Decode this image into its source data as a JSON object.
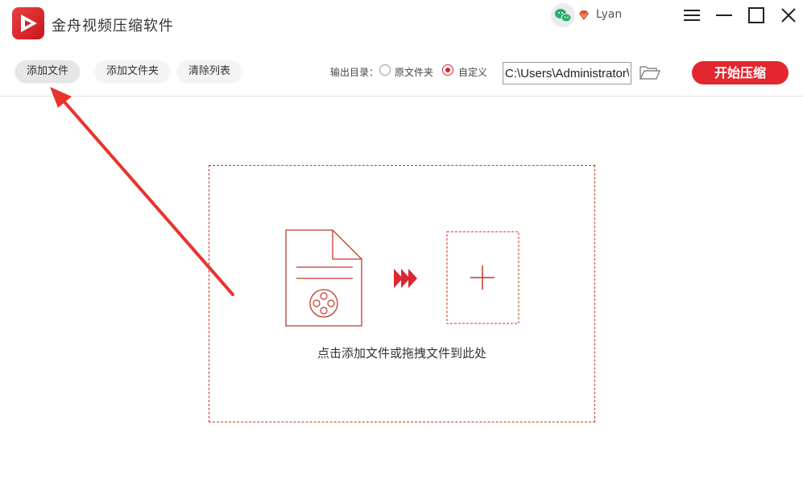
{
  "app": {
    "title": "金舟视频压缩软件",
    "logo_icon": "play-logo-icon",
    "brand_color": "#e2272e"
  },
  "user": {
    "name": "Lyan",
    "wechat_icon": "wechat-icon",
    "vip_icon": "vip-diamond-icon"
  },
  "window_controls": [
    "menu-icon",
    "minimize-icon",
    "maximize-icon",
    "close-icon"
  ],
  "toolbar": {
    "add_file": "添加文件",
    "add_folder": "添加文件夹",
    "clear_list": "清除列表",
    "output_label": "输出目录：",
    "options": [
      {
        "label": "原文件夹",
        "checked": false
      },
      {
        "label": "自定义",
        "checked": true
      }
    ],
    "output_path": "C:\\Users\\Administrator\\",
    "browse_icon": "open-folder-icon",
    "start": "开始压缩"
  },
  "dropzone": {
    "hint": "点击添加文件或拖拽文件到此处",
    "file_icon": "video-file-icon",
    "arrows_icon": "triple-arrow-icon",
    "plus_icon": "plus-icon"
  },
  "annotation": {
    "icon": "red-arrow-annotation",
    "color": "#e8342b"
  }
}
